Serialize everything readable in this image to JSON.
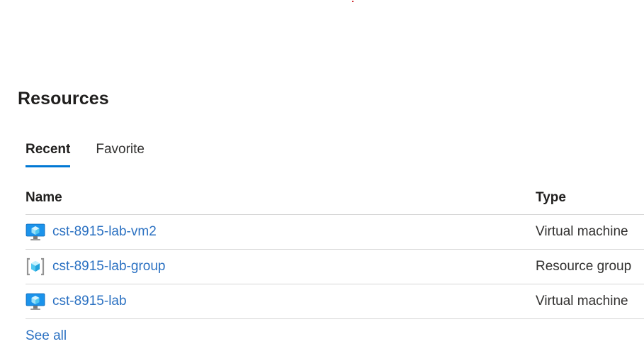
{
  "section": {
    "title": "Resources"
  },
  "tabs": [
    {
      "label": "Recent",
      "active": true
    },
    {
      "label": "Favorite",
      "active": false
    }
  ],
  "table": {
    "columns": {
      "name": "Name",
      "type": "Type"
    },
    "rows": [
      {
        "name": "cst-8915-lab-vm2",
        "type": "Virtual machine",
        "icon": "virtual-machine-icon"
      },
      {
        "name": "cst-8915-lab-group",
        "type": "Resource group",
        "icon": "resource-group-icon"
      },
      {
        "name": "cst-8915-lab",
        "type": "Virtual machine",
        "icon": "virtual-machine-icon"
      }
    ]
  },
  "see_all": "See all",
  "colors": {
    "accent": "#0078d4",
    "link": "#2b71c2",
    "divider": "#d6d6d6"
  }
}
